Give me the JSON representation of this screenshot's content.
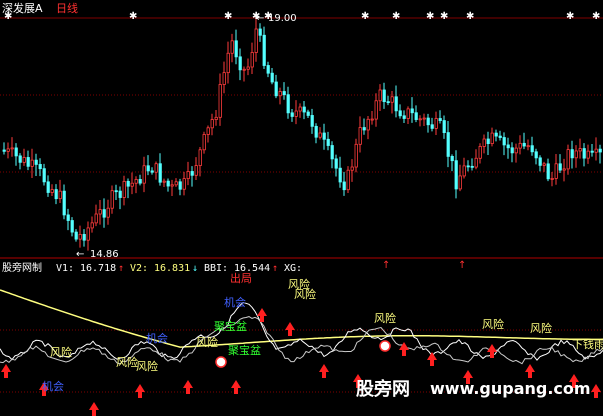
{
  "header": {
    "stock_name": "深发展A",
    "period": "日线"
  },
  "price_panel": {
    "high_label": "19.00",
    "low_label": "14.86",
    "high_marker_prefix": "←",
    "low_marker_prefix": "←"
  },
  "indicator_panel": {
    "name": "股旁网制",
    "v1_label": "V1:",
    "v1_value": "16.718",
    "v2_label": "V2:",
    "v2_value": "16.831",
    "bbi_label": "BBI:",
    "bbi_value": "16.544",
    "xg_label": "XG:",
    "annotations": [
      {
        "text": "出局",
        "color": "#ff3030"
      },
      {
        "text": "风险",
        "color": "#ffff80"
      },
      {
        "text": "风险",
        "color": "#ffff80"
      },
      {
        "text": "风险",
        "color": "#ffff80"
      },
      {
        "text": "风险",
        "color": "#ffff80"
      },
      {
        "text": "风险",
        "color": "#ffff80"
      },
      {
        "text": "风险",
        "color": "#ffff80"
      },
      {
        "text": "风险",
        "color": "#ffff80"
      },
      {
        "text": "风险",
        "color": "#ffff80"
      },
      {
        "text": "风险",
        "color": "#ffff80"
      },
      {
        "text": "下钱雨了",
        "color": "#ffff80"
      },
      {
        "text": "机会",
        "color": "#4060ff"
      },
      {
        "text": "机会",
        "color": "#4060ff"
      },
      {
        "text": "机会",
        "color": "#4060ff"
      },
      {
        "text": "聚宝盆",
        "color": "#30ff30"
      },
      {
        "text": "聚宝盆",
        "color": "#30ff30"
      }
    ]
  },
  "watermark": {
    "text_cn": "股旁网",
    "text_url": "www.gupang.com"
  },
  "colors": {
    "up": "#ff3c3c",
    "down": "#54ffff",
    "bbi": "#ffff80",
    "line": "#ffffff",
    "grid": "#800000",
    "arrow": "#ff2020"
  },
  "chart_data": {
    "type": "candlestick",
    "price_high": 19.0,
    "price_low": 14.86,
    "marked_dates_count": 0
  }
}
